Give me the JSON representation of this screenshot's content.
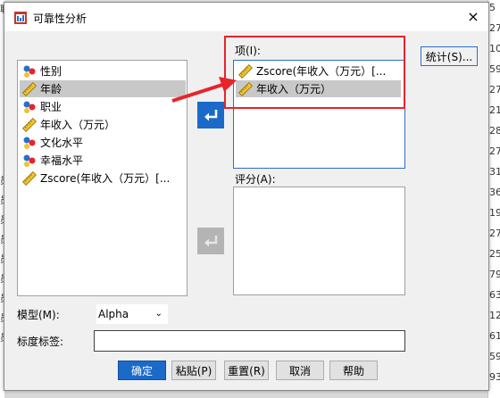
{
  "dialog": {
    "title": "可靠性分析",
    "close": "×"
  },
  "variables": [
    {
      "label": "性别",
      "type": "nominal"
    },
    {
      "label": "年龄",
      "type": "scale",
      "selected": true
    },
    {
      "label": "职业",
      "type": "nominal"
    },
    {
      "label": "年收入（万元）",
      "type": "scale"
    },
    {
      "label": "文化水平",
      "type": "nominal"
    },
    {
      "label": "幸福水平",
      "type": "nominal"
    },
    {
      "label": "Zscore(年收入（万元）[...",
      "type": "scale"
    }
  ],
  "items": {
    "label": "项(I):",
    "list": [
      {
        "label": "Zscore(年收入（万元）[...",
        "type": "scale"
      },
      {
        "label": "年收入（万元）",
        "type": "scale",
        "selected": true
      }
    ]
  },
  "raters": {
    "label": "评分(A):"
  },
  "stats_button": "统计(S)...",
  "model": {
    "label": "模型(M):",
    "value": "Alpha"
  },
  "scale_label": {
    "label": "标度标签:",
    "value": ""
  },
  "buttons": {
    "ok": "确定",
    "paste": "粘贴(P)",
    "reset": "重置(R)",
    "cancel": "取消",
    "help": "帮助"
  },
  "background": {
    "right_values": [
      "5",
      "27",
      "10",
      "59",
      "27",
      "21",
      "28",
      "27",
      "31",
      "36",
      "19",
      "27",
      "25",
      "79",
      "63",
      "12",
      "61",
      "59",
      "93"
    ],
    "left_values": [
      "职",
      "员",
      "员",
      "员",
      "员",
      "员",
      "员",
      "员",
      "员",
      "员"
    ]
  },
  "colors": {
    "accent": "#1b6ac9",
    "annotation_red": "#e8232a",
    "selection": "#c8c8c8"
  }
}
